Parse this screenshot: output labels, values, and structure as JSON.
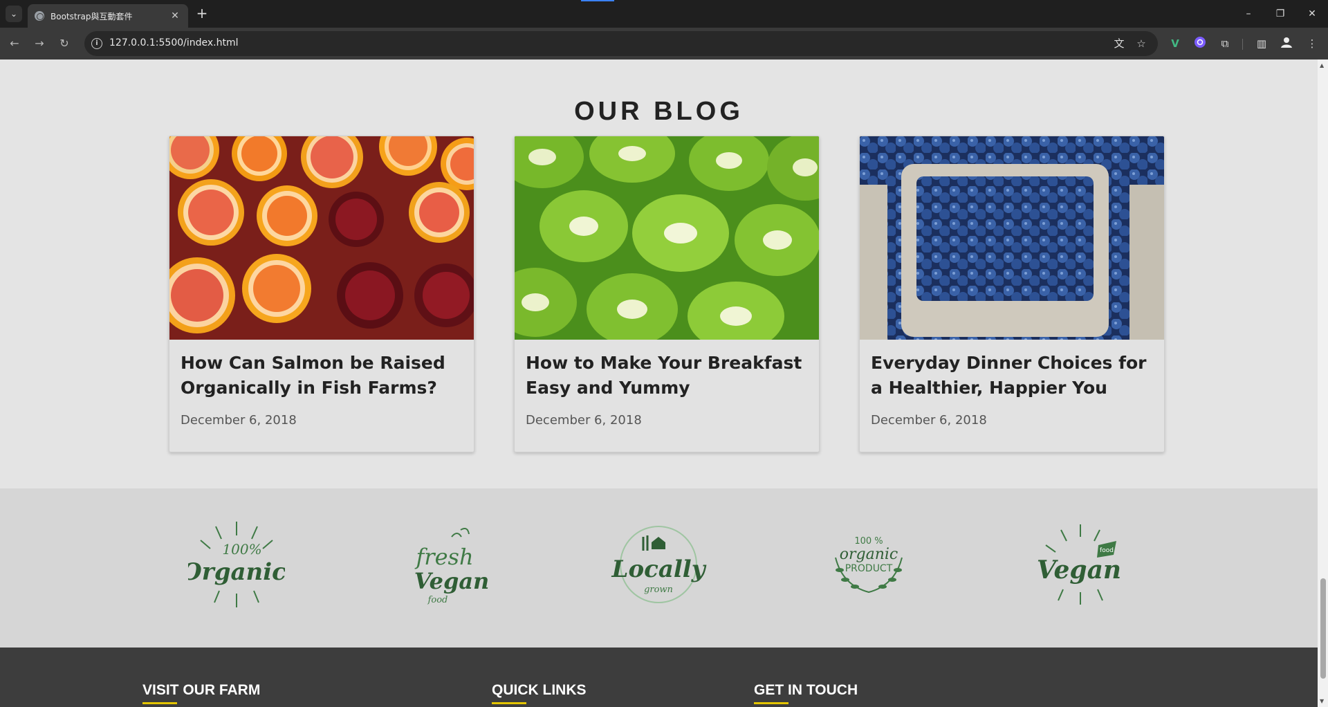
{
  "browser": {
    "tab_title": "Bootstrap與互動套件",
    "tab_close": "✕",
    "new_tab": "+",
    "url": "127.0.0.1:5500/index.html",
    "controls": {
      "minimize": "–",
      "restore": "❐",
      "close": "✕"
    }
  },
  "blog": {
    "heading": "OUR BLOG",
    "posts": [
      {
        "title": "How Can Salmon be Raised Organically in Fish Farms?",
        "date": "December 6, 2018",
        "image": "citrus-pomegranate"
      },
      {
        "title": "How to Make Your Breakfast Easy and Yummy",
        "date": "December 6, 2018",
        "image": "kiwi-slices"
      },
      {
        "title": "Everyday Dinner Choices for a Healthier, Happier You",
        "date": "December 6, 2018",
        "image": "blueberries"
      }
    ]
  },
  "badges": [
    {
      "name": "100% Organic"
    },
    {
      "name": "Fresh Vegan food"
    },
    {
      "name": "Locally grown"
    },
    {
      "name": "100% organic PRODUCT"
    },
    {
      "name": "Vegan food"
    }
  ],
  "footer": {
    "headings": [
      "VISIT OUR FARM",
      "QUICK LINKS",
      "GET IN TOUCH"
    ],
    "accent": "#e3c400"
  },
  "colors": {
    "badge_green": "#3f7a45",
    "footer_bg": "#3d3d3d"
  }
}
